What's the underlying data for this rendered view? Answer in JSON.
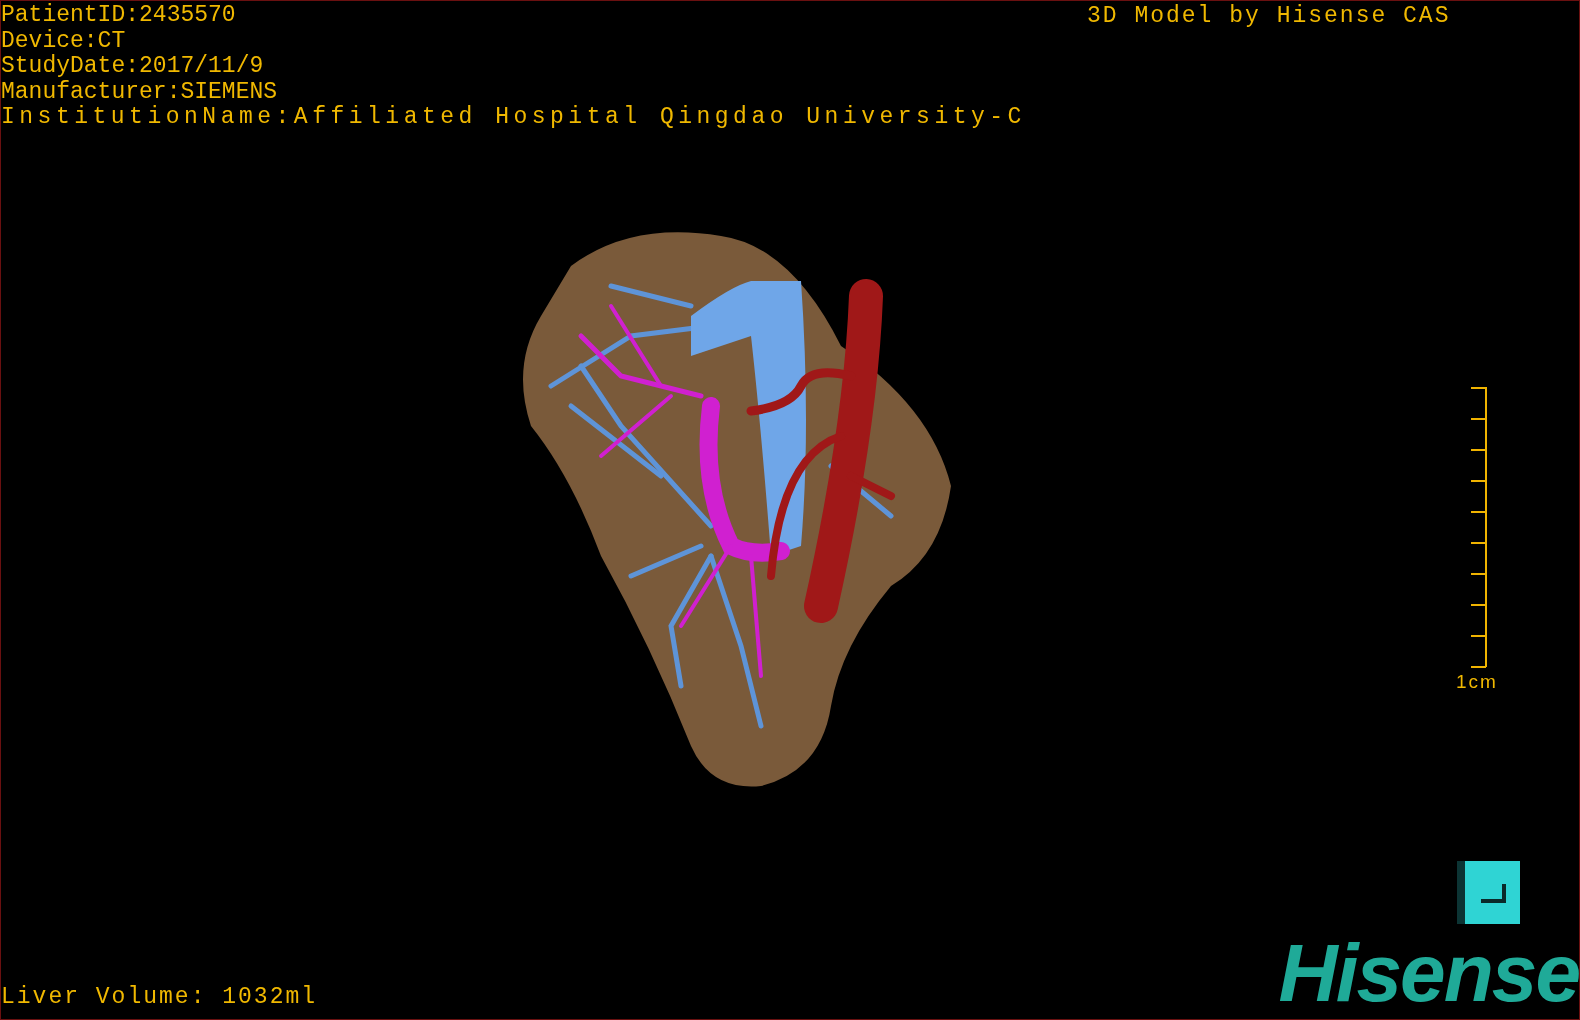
{
  "patient_info": [
    "PatientID:2435570",
    "Device:CT",
    "StudyDate:2017/11/9",
    "Manufacturer:SIEMENS",
    "InstitutionName:Affiliated Hospital Qingdao University-C"
  ],
  "model_credit": "3D Model by Hisense CAS",
  "scale_bar": {
    "label": "1cm"
  },
  "liver_volume": "Liver Volume: 1032ml",
  "logo": "Hisense"
}
